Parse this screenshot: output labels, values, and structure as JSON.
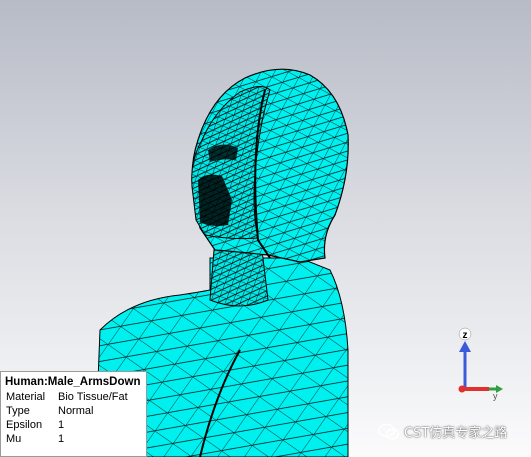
{
  "info_panel": {
    "title": "Human:Male_ArmsDown",
    "rows": [
      {
        "label": "Material",
        "value": "Bio Tissue/Fat"
      },
      {
        "label": "Type",
        "value": "Normal"
      },
      {
        "label": "Epsilon",
        "value": "1"
      },
      {
        "label": "Mu",
        "value": "1"
      }
    ]
  },
  "axis_triad": {
    "z_label": "z",
    "y_label": "y",
    "z_color": "#3b5bdb",
    "x_color": "#e03131",
    "y_color": "#2f9e44"
  },
  "model": {
    "fill_color": "#00f0f0",
    "mesh_color": "#000000"
  },
  "watermark": {
    "icon": "wechat-icon",
    "text": "CST仿真专家之路"
  }
}
